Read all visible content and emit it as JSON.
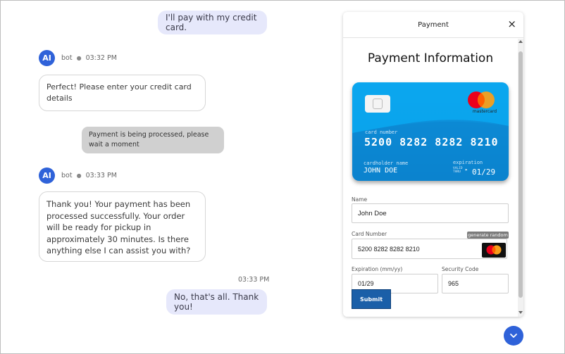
{
  "chat": {
    "user_message_1": "I'll pay with my credit card.",
    "bot_label": "bot",
    "bot_time_1": "03:32 PM",
    "bot_message_1": "Perfect! Please enter your credit card details",
    "system_message": "Payment is being processed, please wait a moment",
    "bot_time_2": "03:33 PM",
    "bot_message_2": "Thank you! Your payment has been processed successfully. Your order will be ready for pickup in approximately 30 minutes. Is there anything else I can assist you with?",
    "user_time_2": "03:33 PM",
    "user_message_2": "No, that's all. Thank you!",
    "avatar_text": "AI"
  },
  "panel": {
    "header_title": "Payment",
    "close_label": "×",
    "title": "Payment Information"
  },
  "card": {
    "brand": "mastercard",
    "number_label": "card number",
    "number": "5200 8282 8282 8210",
    "holder_label": "cardholder name",
    "holder": "JOHN DOE",
    "expiration_label": "expiration",
    "valid_thru_label_1": "VALID",
    "valid_thru_label_2": "THRU",
    "expiration": "01/29"
  },
  "form": {
    "name_label": "Name",
    "name_value": "John Doe",
    "card_number_label": "Card Number",
    "generate_random_label": "generate random",
    "card_number_value": "5200 8282 8282 8210",
    "expiration_label": "Expiration (mm/yy)",
    "expiration_value": "01/29",
    "security_code_label": "Security Code",
    "security_code_value": "965",
    "submit_label": "Submit"
  },
  "colors": {
    "accent": "#2f62d9",
    "user_bubble": "#e6e8fb",
    "card_blue": "#0d8ed8",
    "submit": "#1b5fa8"
  },
  "icons": {
    "close": "close-icon",
    "scroll_down": "chevron-down-icon",
    "mastercard": "mastercard-logo"
  }
}
